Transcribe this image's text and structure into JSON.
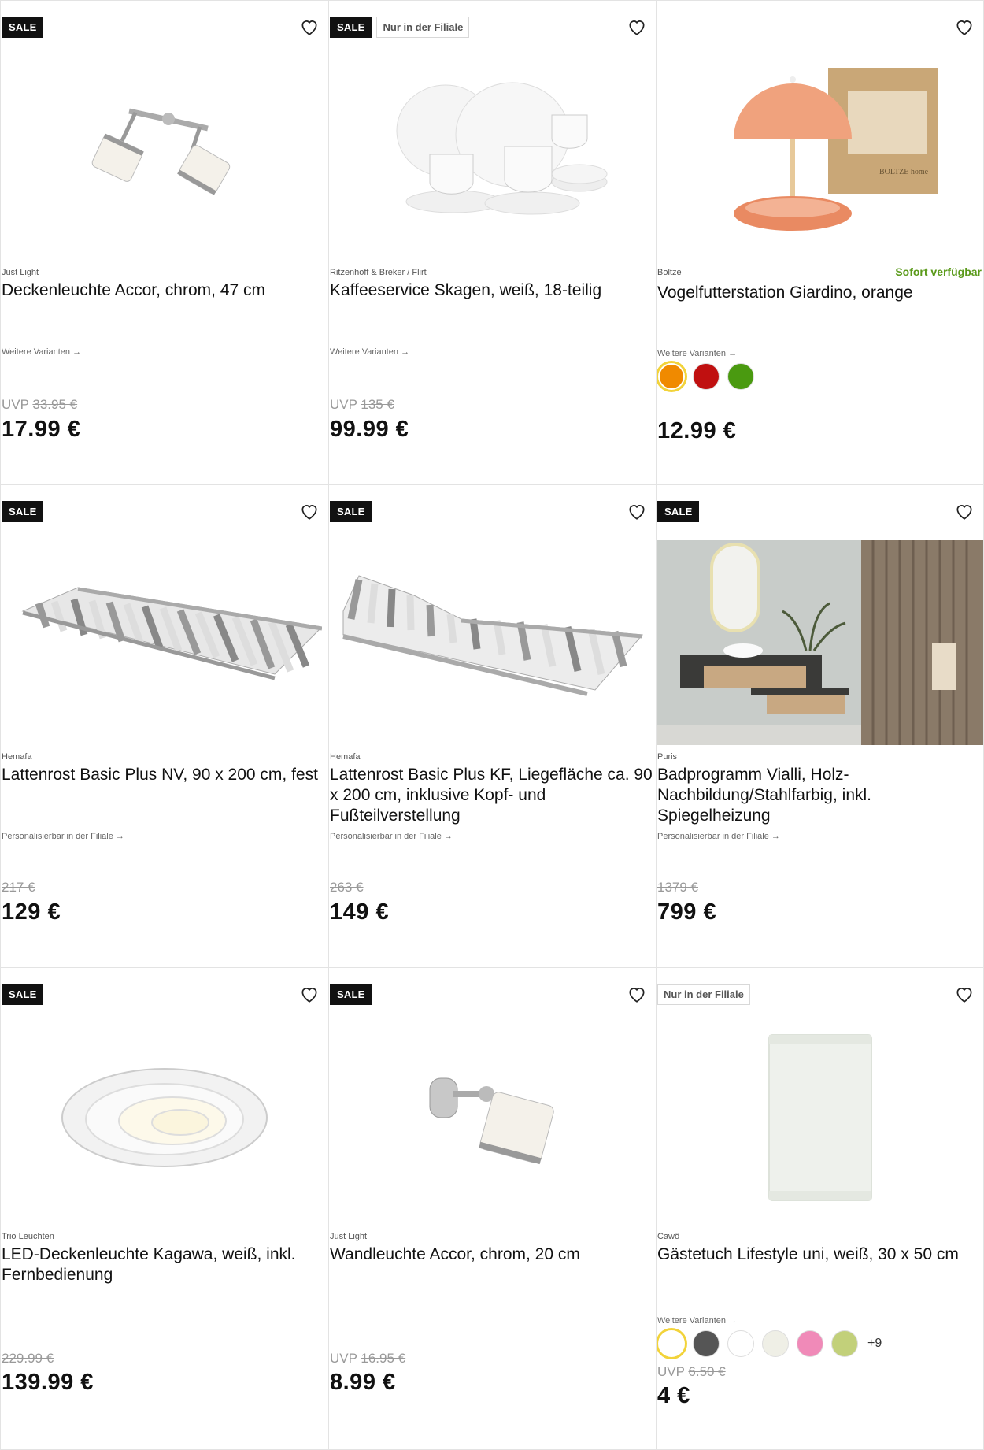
{
  "products": [
    {
      "brand": "Just Light",
      "title": "Deckenleuchte Accor, chrom, 47 cm",
      "badge_sale": "SALE",
      "badge_filiale": "",
      "link": "Weitere Varianten →",
      "uvp_label": "UVP",
      "old_price": "33.95 €",
      "price": "17.99 €",
      "image": "ceiling-spotlight",
      "availability": ""
    },
    {
      "brand": "Ritzenhoff & Breker / Flirt",
      "title": "Kaffeeservice Skagen, weiß, 18-teilig",
      "badge_sale": "SALE",
      "badge_filiale": "Nur in der Filiale",
      "link": "Weitere Varianten →",
      "uvp_label": "UVP",
      "old_price": "135 €",
      "price": "99.99 €",
      "image": "coffee-set",
      "availability": ""
    },
    {
      "brand": "Boltze",
      "title": "Vogelfutterstation Giardino, orange",
      "badge_sale": "",
      "badge_filiale": "",
      "link": "Weitere Varianten →",
      "uvp_label": "",
      "old_price": "",
      "price": "12.99 €",
      "image": "bird-feeder",
      "availability": "Sofort verfügbar",
      "swatches": [
        "#f08a00",
        "#c01010",
        "#4a9a10"
      ],
      "box_text": "BOLTZE home"
    },
    {
      "brand": "Hemafa",
      "title": "Lattenrost Basic Plus NV, 90 x 200 cm, fest",
      "badge_sale": "SALE",
      "badge_filiale": "",
      "link": "Personalisierbar in der Filiale →",
      "uvp_label": "",
      "old_price": "217 €",
      "price": "129 €",
      "image": "slatted-frame-flat",
      "availability": ""
    },
    {
      "brand": "Hemafa",
      "title": "Lattenrost Basic Plus KF, Liegefläche ca. 90 x 200 cm, inklusive Kopf- und Fußteilverstellung",
      "badge_sale": "SALE",
      "badge_filiale": "",
      "link": "Personalisierbar in der Filiale →",
      "uvp_label": "",
      "old_price": "263 €",
      "price": "149 €",
      "image": "slatted-frame-adjustable",
      "availability": ""
    },
    {
      "brand": "Puris",
      "title": "Badprogramm Vialli, Holz-Nachbildung/Stahlfarbig, inkl. Spiegelheizung",
      "badge_sale": "SALE",
      "badge_filiale": "",
      "link": "Personalisierbar in der Filiale →",
      "uvp_label": "",
      "old_price": "1379 €",
      "price": "799 €",
      "image": "bathroom-set",
      "availability": ""
    },
    {
      "brand": "Trio Leuchten",
      "title": "LED-Deckenleuchte Kagawa, weiß, inkl. Fernbedienung",
      "badge_sale": "SALE",
      "badge_filiale": "",
      "link": "",
      "uvp_label": "",
      "old_price": "229.99 €",
      "price": "139.99 €",
      "image": "led-ceiling-light",
      "availability": ""
    },
    {
      "brand": "Just Light",
      "title": "Wandleuchte Accor, chrom, 20 cm",
      "badge_sale": "SALE",
      "badge_filiale": "",
      "link": "",
      "uvp_label": "UVP",
      "old_price": "16.95 €",
      "price": "8.99 €",
      "image": "wall-light",
      "availability": ""
    },
    {
      "brand": "Cawö",
      "title": "Gästetuch Lifestyle uni, weiß, 30 x 50 cm",
      "badge_sale": "",
      "badge_filiale": "Nur in der Filiale",
      "link": "Weitere Varianten →",
      "uvp_label": "UVP",
      "old_price": "6.50 €",
      "price": "4 €",
      "image": "guest-towel",
      "availability": "",
      "swatches": [
        "#ffffff",
        "#555555",
        "#ffffff",
        "#efefe6",
        "#f08ab8",
        "#c2d07a"
      ],
      "more_swatches": "+9"
    }
  ],
  "colors": {
    "sale_badge": "#111111",
    "availability": "#5a9a1a",
    "selected_swatch_ring": "#f2d33a"
  }
}
